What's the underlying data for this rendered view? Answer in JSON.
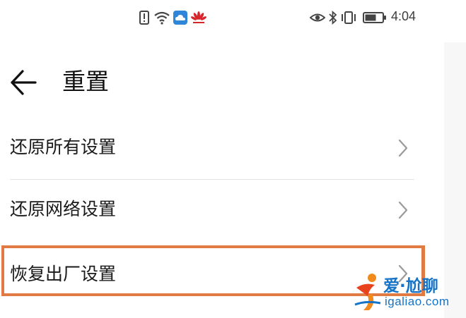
{
  "status_bar": {
    "time": "4:04",
    "left_icons": [
      "alert-icon",
      "wifi-icon",
      "cloud-icon",
      "huawei-logo"
    ],
    "right_icons": [
      "eye-icon",
      "bluetooth-icon",
      "vibrate-icon",
      "battery-icon"
    ]
  },
  "header": {
    "title": "重置",
    "back_icon": "arrow-left-icon"
  },
  "items": [
    {
      "label": "还原所有设置",
      "icon": "chevron-right-icon"
    },
    {
      "label": "还原网络设置",
      "icon": "chevron-right-icon"
    },
    {
      "label": "恢复出厂设置",
      "icon": "chevron-right-icon"
    }
  ],
  "highlight_color": "#e27a43",
  "watermark": {
    "title": "爱·尬聊",
    "url": "igaliao.com",
    "color": "#1673c6"
  }
}
